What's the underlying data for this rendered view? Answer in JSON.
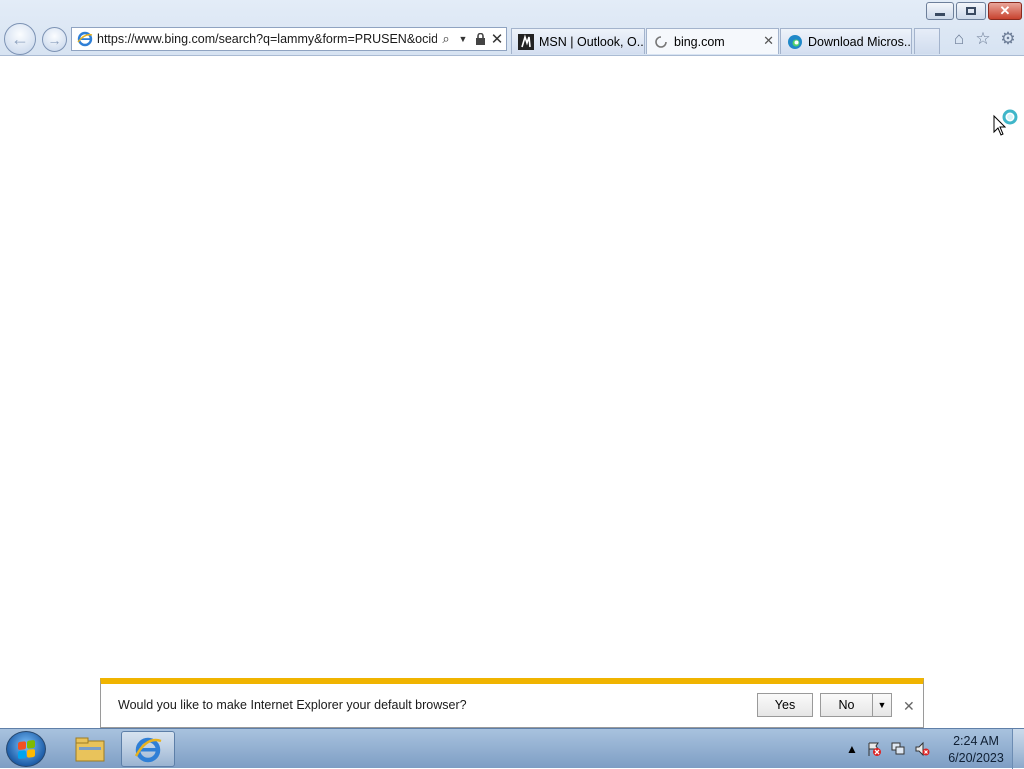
{
  "window": {
    "minimize_label": "",
    "close_label": "✕"
  },
  "address_bar": {
    "url": "https://www.bing.com/search?q=lammy&form=PRUSEN&ocid="
  },
  "tabs": [
    {
      "label": "MSN | Outlook, O...",
      "icon": "msn-icon"
    },
    {
      "label": "bing.com",
      "icon": "loading-icon",
      "close": "✕"
    },
    {
      "label": "Download Micros...",
      "icon": "edge-icon"
    }
  ],
  "notification": {
    "message": "Would you like to make Internet Explorer your default browser?",
    "yes_label": "Yes",
    "no_label": "No",
    "close_label": "✕",
    "accent_color": "#f0b400"
  },
  "taskbar": {
    "clock_time": "2:24 AM",
    "clock_date": "6/20/2023"
  }
}
